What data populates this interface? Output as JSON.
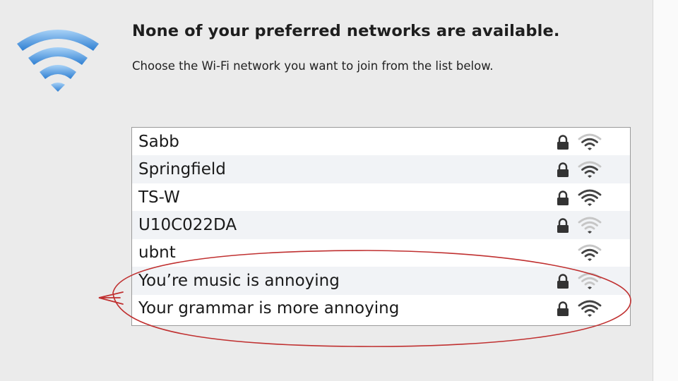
{
  "dialog": {
    "headline": "None of your preferred networks are available.",
    "subline": "Choose the Wi-Fi network you want to join from the list below.",
    "logo_icon": "wifi-icon",
    "logo_color": "#3c8fe0"
  },
  "networks": [
    {
      "name": "Sabb",
      "locked": true,
      "signal_bars": 3
    },
    {
      "name": "Springfield",
      "locked": true,
      "signal_bars": 3
    },
    {
      "name": "TS-W",
      "locked": true,
      "signal_bars": 4
    },
    {
      "name": "U10C022DA",
      "locked": true,
      "signal_bars": 1
    },
    {
      "name": "ubnt",
      "locked": false,
      "signal_bars": 3
    },
    {
      "name": "You’re music is annoying",
      "locked": true,
      "signal_bars": 1
    },
    {
      "name": "Your grammar is more annoying",
      "locked": true,
      "signal_bars": 4
    }
  ],
  "annotation": {
    "shape": "ellipse",
    "arrow": "double-arrow-left",
    "color": "#c03030"
  }
}
